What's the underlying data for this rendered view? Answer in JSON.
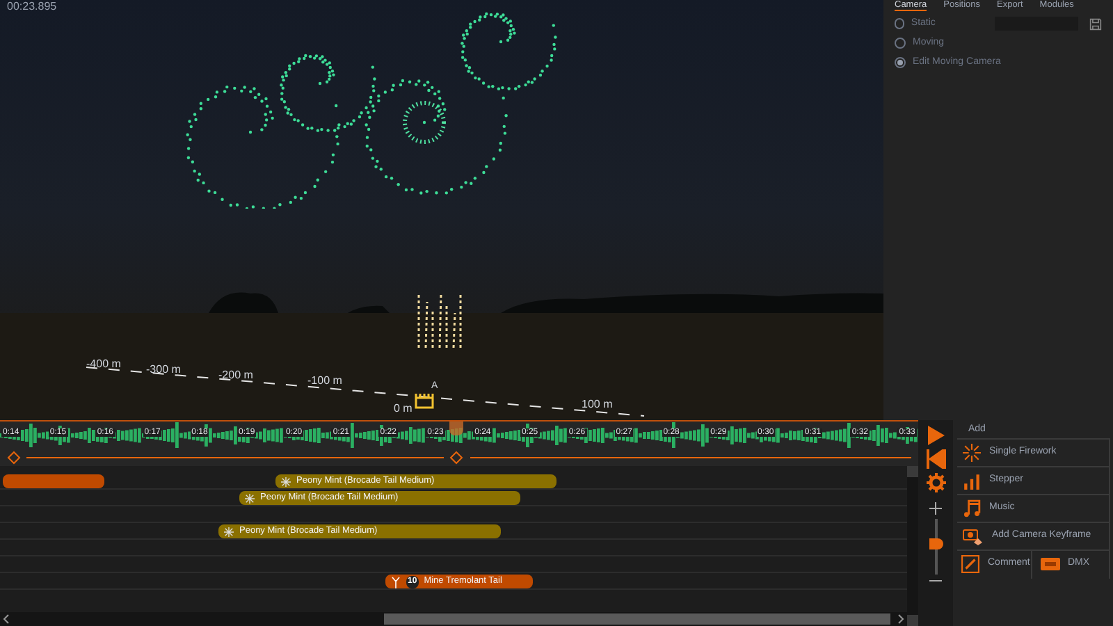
{
  "viewport": {
    "timecode": "00:23.895",
    "distance_labels": [
      "-400 m",
      "-300 m",
      "-200 m",
      "-100 m",
      "0 m",
      "100 m"
    ],
    "marker_label": "A"
  },
  "side_tabs": [
    {
      "label": "Camera",
      "selected": true
    },
    {
      "label": "Positions",
      "selected": false
    },
    {
      "label": "Export",
      "selected": false
    },
    {
      "label": "Modules",
      "selected": false
    }
  ],
  "camera_modes": [
    {
      "label": "Static",
      "selected": false
    },
    {
      "label": "Moving",
      "selected": false
    },
    {
      "label": "Edit Moving Camera",
      "selected": true
    }
  ],
  "timeline": {
    "ticks": [
      "0:14",
      "0:15",
      "0:16",
      "0:17",
      "0:18",
      "0:19",
      "0:20",
      "0:21",
      "0:22",
      "0:23",
      "0:24",
      "0:25",
      "0:26",
      "0:27",
      "0:28",
      "0:29",
      "0:30",
      "0:31",
      "0:32",
      "0:33"
    ],
    "clips": [
      {
        "kind": "plain",
        "color": "#c04a00"
      },
      {
        "kind": "firework",
        "color": "#8a7000",
        "label": "Peony Mint (Brocade Tail Medium)"
      },
      {
        "kind": "firework",
        "color": "#8a7000",
        "label": "Peony Mint (Brocade Tail Medium)"
      },
      {
        "kind": "firework",
        "color": "#8a7000",
        "label": "Peony Mint (Brocade Tail Medium)"
      },
      {
        "kind": "mine",
        "color": "#c04a00",
        "count": "10",
        "label": "Mine Tremolant Tail"
      }
    ]
  },
  "zoom_slider": {
    "level": 0.55
  },
  "add_panel": {
    "title": "Add",
    "buttons": [
      {
        "kind": "firework",
        "label": "Single Firework"
      },
      {
        "kind": "stepper",
        "label": "Stepper"
      },
      {
        "kind": "music",
        "label": "Music"
      },
      {
        "kind": "camera",
        "label": "Add Camera Keyframe"
      }
    ],
    "bottom_buttons": [
      {
        "kind": "comment",
        "label": "Comment"
      },
      {
        "kind": "dmx",
        "label": "DMX"
      }
    ]
  }
}
